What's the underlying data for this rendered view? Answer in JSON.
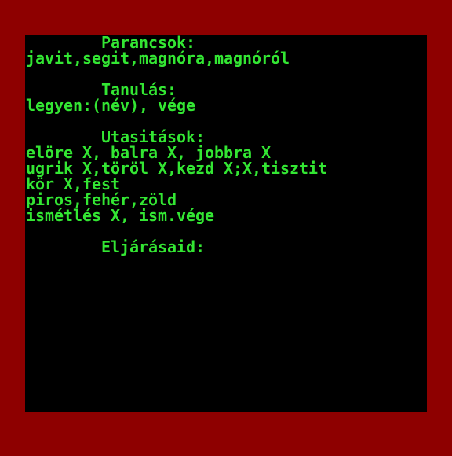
{
  "colors": {
    "border": "#8e0000",
    "screen": "#000000",
    "text": "#33e633"
  },
  "sections": {
    "commands": {
      "heading": "Parancsok:",
      "lines": [
        "javit,segit,magnóra,magnóról"
      ]
    },
    "learning": {
      "heading": "Tanulás:",
      "lines": [
        "legyen:(név), vége"
      ]
    },
    "instructions": {
      "heading": "Utasitások:",
      "lines": [
        "elöre X, balra X, jobbra X",
        "ugrik X,töröl X,kezd X;X,tisztit",
        "kör X,fest",
        "piros,fehér,zöld",
        "ismétlés X, ism.vége"
      ]
    },
    "procedures": {
      "heading": "Eljárásaid:",
      "lines": []
    }
  }
}
